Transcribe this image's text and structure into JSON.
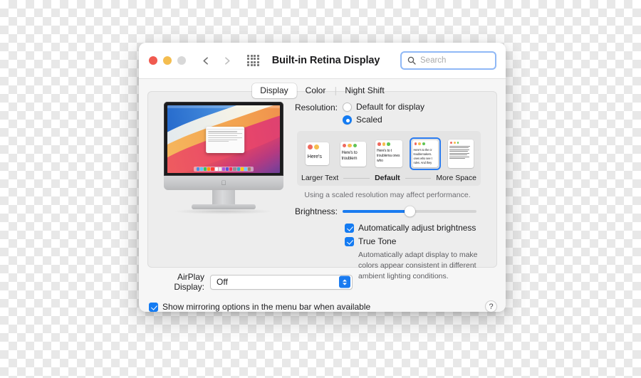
{
  "window": {
    "title": "Built-in Retina Display",
    "traffic_lights": [
      "close",
      "minimize",
      "zoom"
    ],
    "nav_back": "‹",
    "nav_forward": "›",
    "grid_icon": "show-all-icon"
  },
  "search": {
    "placeholder": "Search",
    "value": "",
    "icon": "search-icon"
  },
  "tabs": [
    {
      "label": "Display",
      "selected": true
    },
    {
      "label": "Color",
      "selected": false
    },
    {
      "label": "Night Shift",
      "selected": false
    }
  ],
  "preview": {
    "device": "imac-illustration",
    "apple_logo": "",
    "wallpaper": "big-sur-gradient",
    "dock_icon_colors": [
      "#4a90e2",
      "#5ac8fa",
      "#34c759",
      "#ff9500",
      "#ff3b30",
      "#ffffff",
      "#e8e8ed",
      "#af52de",
      "#5856d6",
      "#ff2d55",
      "#8e8e93",
      "#30b0c7",
      "#ffcc00",
      "#64d2ff",
      "#a2845e"
    ]
  },
  "resolution": {
    "label": "Resolution:",
    "options": [
      {
        "label": "Default for display",
        "selected": false
      },
      {
        "label": "Scaled",
        "selected": true
      }
    ],
    "scaled_thumbnails": [
      {
        "id": "larger-text",
        "text": "Here's",
        "selected": false
      },
      {
        "id": "scale-2",
        "text": "Here's to troublem",
        "selected": false
      },
      {
        "id": "scale-3",
        "text": "Here's to t troublema ones who",
        "selected": false
      },
      {
        "id": "default",
        "text": "Here's to the cr troublemakers. ones who see t rules. And they",
        "selected": true
      },
      {
        "id": "more-space",
        "text": "Here's to the crazy ones troublemakers. The rou ones who see things dif rules. And they have no can quote them, disagr them. About the only th Because they change t",
        "selected": false
      }
    ],
    "scale_labels": {
      "left": "Larger Text",
      "middle": "Default",
      "right": "More Space"
    },
    "note": "Using a scaled resolution may affect performance."
  },
  "brightness": {
    "label": "Brightness:",
    "value_percent": 50
  },
  "checkboxes": [
    {
      "label": "Automatically adjust brightness",
      "checked": true
    },
    {
      "label": "True Tone",
      "checked": true
    }
  ],
  "true_tone_description": "Automatically adapt display to make colors appear consistent in different ambient lighting conditions.",
  "airplay": {
    "label": "AirPlay Display:",
    "value": "Off",
    "options": [
      "Off"
    ]
  },
  "mirroring": {
    "label": "Show mirroring options in the menu bar when available",
    "checked": true
  },
  "help": {
    "label": "?"
  },
  "colors": {
    "accent": "#147bf2",
    "traffic_red": "#f05a4f",
    "traffic_yellow": "#f4bd4f",
    "traffic_gray": "#d8d8d8"
  }
}
